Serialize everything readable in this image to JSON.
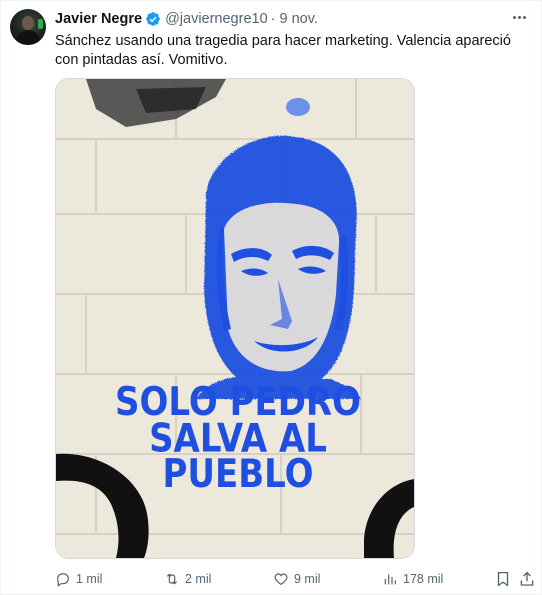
{
  "tweet": {
    "author": {
      "name": "Javier Negre",
      "handle": "@javiernegre10",
      "separator": "·",
      "time": "9 nov."
    },
    "text": "Sánchez usando una tragedia para hacer marketing. Valencia apareció con pintadas así. Vomitivo.",
    "media": {
      "stencil_text_line1": "SOLO PEDRO",
      "stencil_text_line2": "SALVA AL",
      "stencil_text_line3": "PUEBLO"
    },
    "actions": {
      "replies": "1 mil",
      "reposts": "2 mil",
      "likes": "9 mil",
      "views": "178 mil"
    }
  },
  "icons": {
    "verified": "verified-badge-icon",
    "more": "more-options-icon",
    "reply": "reply-icon",
    "repost": "repost-icon",
    "like": "heart-icon",
    "views": "views-chart-icon",
    "bookmark": "bookmark-icon",
    "share": "share-icon"
  },
  "colors": {
    "accent": "#1d9bf0",
    "secondary_text": "#536471",
    "stencil_blue": "#1f4fe0"
  }
}
